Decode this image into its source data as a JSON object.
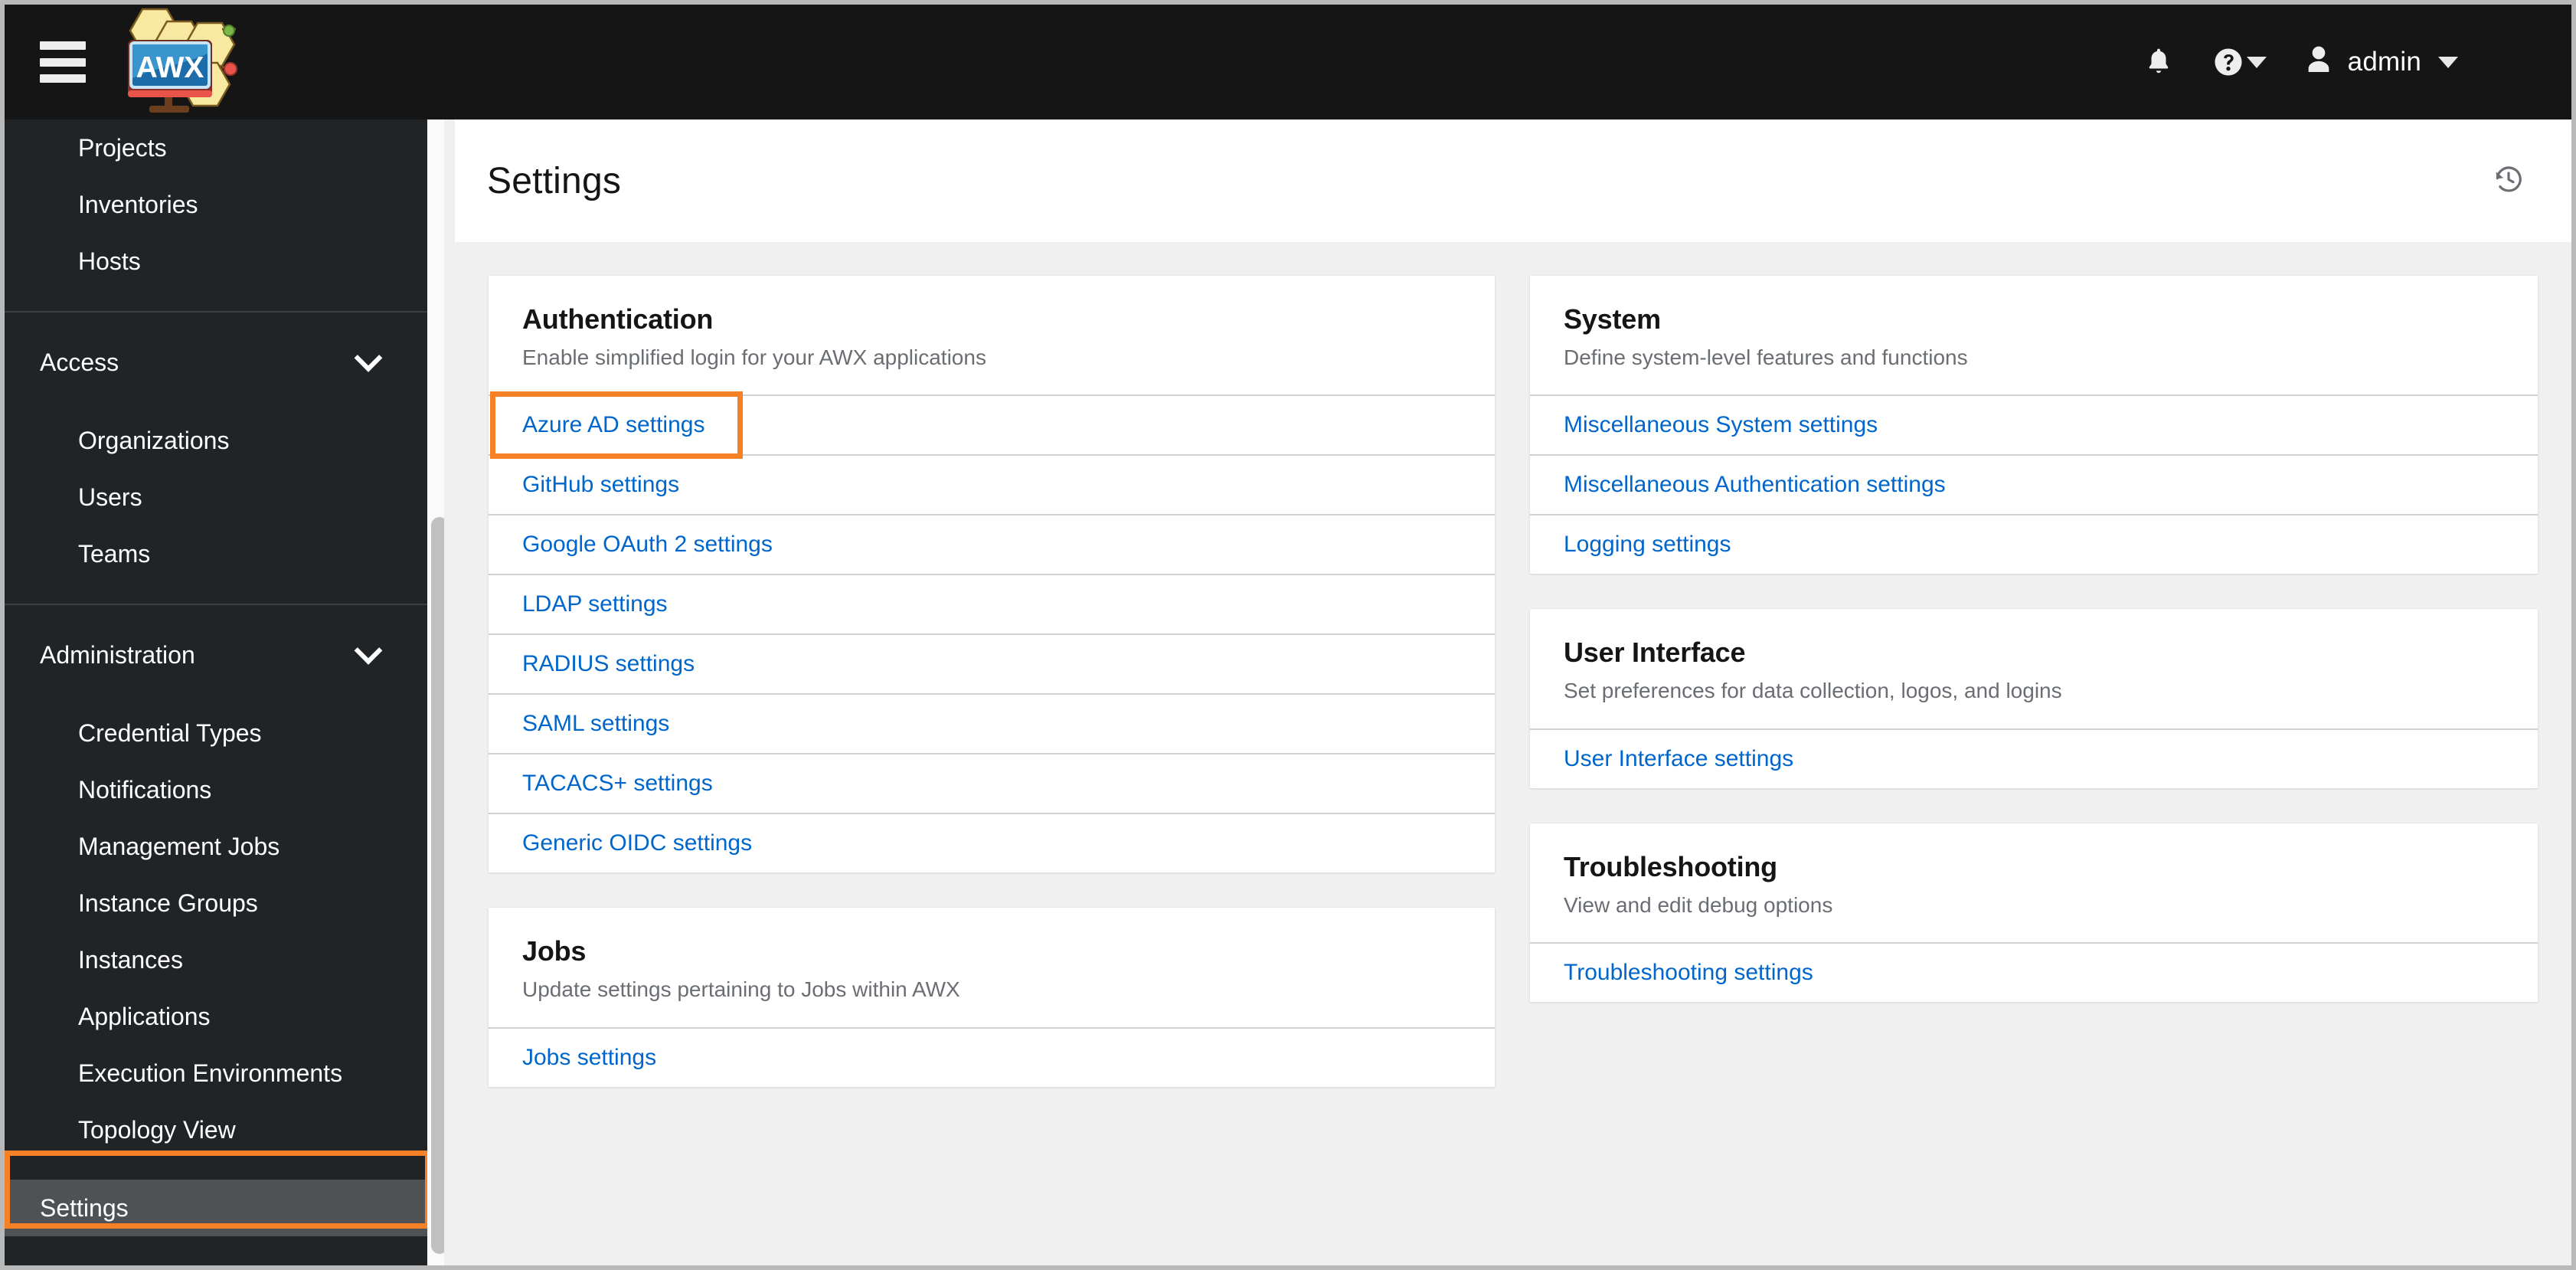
{
  "masthead": {
    "brand_text": "AWX",
    "hamburger_label": "Global navigation toggle",
    "notifications_icon": "bell-icon",
    "help_icon": "question-circle-icon",
    "user_icon": "user-icon",
    "user_name": "admin",
    "accent_color": "#f58026"
  },
  "sidebar": {
    "groups": [
      {
        "label": "",
        "items": [
          {
            "label": "Projects"
          },
          {
            "label": "Inventories"
          },
          {
            "label": "Hosts"
          }
        ]
      },
      {
        "label": "Access",
        "expanded": true,
        "items": [
          {
            "label": "Organizations"
          },
          {
            "label": "Users"
          },
          {
            "label": "Teams"
          }
        ]
      },
      {
        "label": "Administration",
        "expanded": true,
        "items": [
          {
            "label": "Credential Types"
          },
          {
            "label": "Notifications"
          },
          {
            "label": "Management Jobs"
          },
          {
            "label": "Instance Groups"
          },
          {
            "label": "Instances"
          },
          {
            "label": "Applications"
          },
          {
            "label": "Execution Environments"
          },
          {
            "label": "Topology View"
          }
        ]
      }
    ],
    "active_item": {
      "label": "Settings",
      "highlighted": true
    }
  },
  "page": {
    "title": "Settings",
    "history_icon": "history-icon"
  },
  "cards": {
    "left": [
      {
        "title": "Authentication",
        "subtitle": "Enable simplified login for your AWX applications",
        "links": [
          {
            "label": "Azure AD settings",
            "highlighted": true
          },
          {
            "label": "GitHub settings"
          },
          {
            "label": "Google OAuth 2 settings"
          },
          {
            "label": "LDAP settings"
          },
          {
            "label": "RADIUS settings"
          },
          {
            "label": "SAML settings"
          },
          {
            "label": "TACACS+ settings"
          },
          {
            "label": "Generic OIDC settings"
          }
        ]
      },
      {
        "title": "Jobs",
        "subtitle": "Update settings pertaining to Jobs within AWX",
        "links": [
          {
            "label": "Jobs settings"
          }
        ]
      }
    ],
    "right": [
      {
        "title": "System",
        "subtitle": "Define system-level features and functions",
        "links": [
          {
            "label": "Miscellaneous System settings"
          },
          {
            "label": "Miscellaneous Authentication settings"
          },
          {
            "label": "Logging settings"
          }
        ]
      },
      {
        "title": "User Interface",
        "subtitle": "Set preferences for data collection, logos, and logins",
        "links": [
          {
            "label": "User Interface settings"
          }
        ]
      },
      {
        "title": "Troubleshooting",
        "subtitle": "View and edit debug options",
        "links": [
          {
            "label": "Troubleshooting settings"
          }
        ]
      }
    ]
  }
}
